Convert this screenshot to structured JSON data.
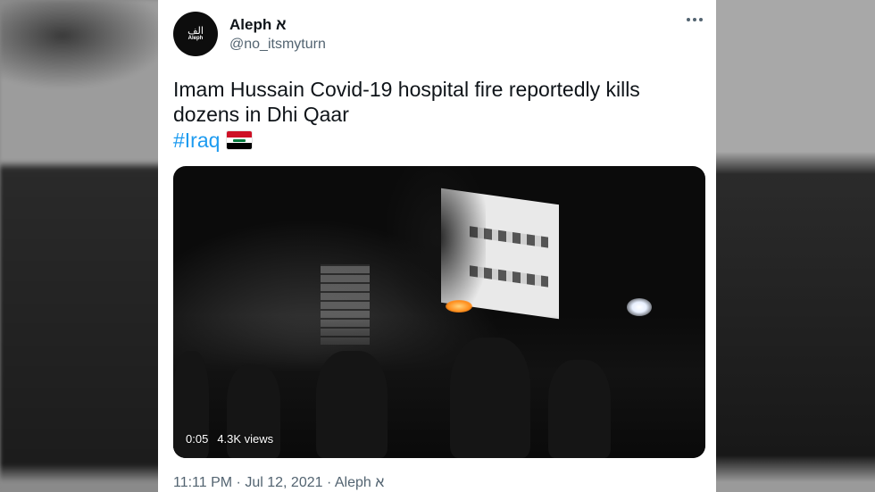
{
  "tweet": {
    "author": {
      "display_name": "Aleph א",
      "handle": "@no_itsmyturn",
      "avatar_mark": "الف",
      "avatar_sub": "Aleph"
    },
    "text": "Imam Hussain Covid-19 hospital fire reportedly kills dozens in Dhi Qaar",
    "hashtag": "#Iraq",
    "flag_icon": "iraq-flag-icon",
    "media": {
      "duration": "0:05",
      "views": "4.3K views"
    },
    "footer": "11:11 PM · Jul 12, 2021 · Aleph א"
  },
  "colors": {
    "link": "#1d9bf0",
    "text": "#0f1419",
    "muted": "#536471"
  }
}
